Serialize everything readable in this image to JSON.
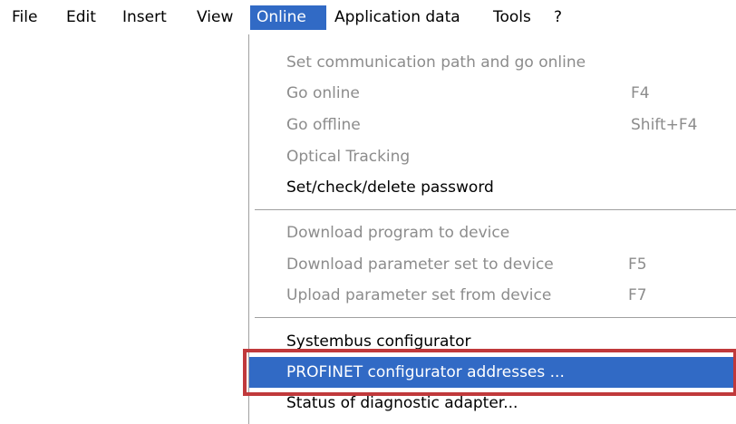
{
  "menubar": {
    "items": [
      {
        "label": "File"
      },
      {
        "label": "Edit"
      },
      {
        "label": "Insert"
      },
      {
        "label": "View"
      },
      {
        "label": "Online"
      },
      {
        "label": "Application data"
      },
      {
        "label": "Tools"
      },
      {
        "label": "?"
      }
    ],
    "active": "Online"
  },
  "dropdown": {
    "items": [
      {
        "label": "Set communication path and go online",
        "shortcut": "",
        "enabled": false
      },
      {
        "label": "Go online",
        "shortcut": "F4",
        "enabled": false
      },
      {
        "label": "Go offline",
        "shortcut": "Shift+F4",
        "enabled": false
      },
      {
        "label": "Optical Tracking",
        "shortcut": "",
        "enabled": false
      },
      {
        "label": "Set/check/delete password",
        "shortcut": "",
        "enabled": true
      },
      {
        "label": "Download program to device",
        "shortcut": "",
        "enabled": false
      },
      {
        "label": "Download parameter set to device",
        "shortcut": "F5",
        "enabled": false
      },
      {
        "label": "Upload parameter set from device",
        "shortcut": "F7",
        "enabled": false
      },
      {
        "label": "Systembus configurator",
        "shortcut": "",
        "enabled": true
      },
      {
        "label": "PROFINET configurator addresses ...",
        "shortcut": "",
        "enabled": true,
        "highlighted": true
      },
      {
        "label": "Status of diagnostic adapter...",
        "shortcut": "",
        "enabled": true
      }
    ]
  },
  "colors": {
    "selection": "#316ac5",
    "disabled_text": "#8c8c8c",
    "annotation_box": "#c0393b"
  }
}
